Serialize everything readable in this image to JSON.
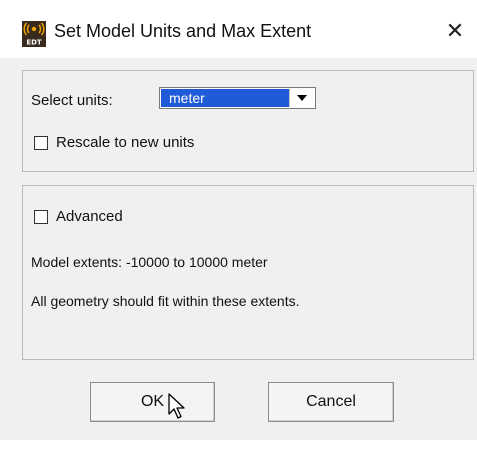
{
  "window": {
    "title": "Set Model Units and Max Extent",
    "icon": "edt-app-icon",
    "close_glyph": "✕",
    "icon_text": "EDT"
  },
  "units": {
    "select_label": "Select units:",
    "selected_value": "meter",
    "selection_color": "#1f5bd6",
    "rescale_label": "Rescale to new units",
    "rescale_checked": false
  },
  "extents": {
    "advanced_label": "Advanced",
    "advanced_checked": false,
    "extents_text": "Model extents: -10000 to 10000 meter",
    "note_text": "All geometry should fit within these extents."
  },
  "buttons": {
    "ok_label": "OK",
    "cancel_label": "Cancel"
  }
}
